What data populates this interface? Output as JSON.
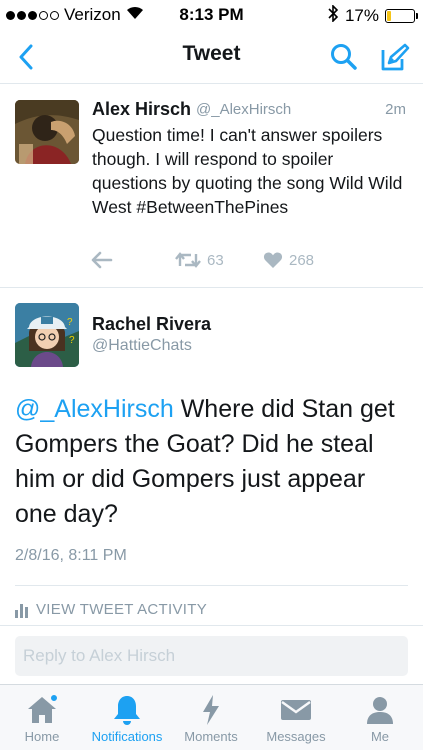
{
  "status_bar": {
    "carrier": "Verizon",
    "time": "8:13 PM",
    "battery_percent": "17%",
    "battery_level": 0.17
  },
  "nav": {
    "title": "Tweet",
    "icons": [
      "back-chevron-icon",
      "search-icon",
      "compose-icon"
    ]
  },
  "parent_tweet": {
    "name": "Alex Hirsch",
    "handle": "@_AlexHirsch",
    "time": "2m",
    "text": "Question time!  I can't answer spoilers though. I will respond to spoiler questions by quoting the song Wild Wild West #BetweenThePines",
    "retweets": "63",
    "likes": "268"
  },
  "main_tweet": {
    "name": "Rachel Rivera",
    "handle": "@HattieChats",
    "mention": "@_AlexHirsch",
    "text": " Where did Stan get Gompers the Goat? Did he steal him or did Gompers just appear one day?",
    "date": "2/8/16, 8:11 PM",
    "activity_label": "VIEW TWEET ACTIVITY"
  },
  "reply": {
    "placeholder": "Reply to Alex Hirsch"
  },
  "tabs": [
    {
      "label": "Home",
      "icon": "home-icon",
      "active": false,
      "has_dot": true
    },
    {
      "label": "Notifications",
      "icon": "bell-icon",
      "active": true,
      "has_dot": false
    },
    {
      "label": "Moments",
      "icon": "lightning-icon",
      "active": false,
      "has_dot": false
    },
    {
      "label": "Messages",
      "icon": "envelope-icon",
      "active": false,
      "has_dot": false
    },
    {
      "label": "Me",
      "icon": "person-icon",
      "active": false,
      "has_dot": false
    }
  ],
  "colors": {
    "accent": "#1da1f2",
    "muted": "#8899a6",
    "battery": "#f5c518"
  }
}
